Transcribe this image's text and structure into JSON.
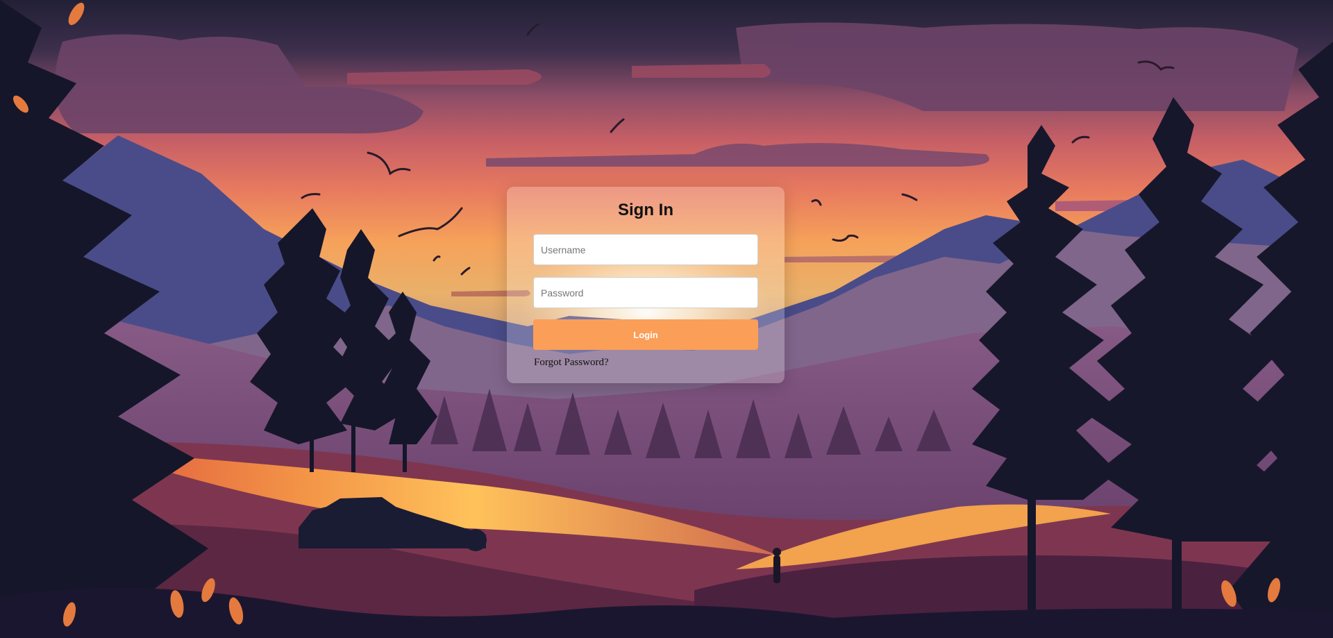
{
  "login": {
    "title": "Sign In",
    "username_placeholder": "Username",
    "password_placeholder": "Password",
    "username_value": "",
    "password_value": "",
    "login_label": "Login",
    "forgot_label": "Forgot Password?"
  },
  "theme": {
    "accent": "#fb9e58",
    "sky_top": "#252238",
    "sky_glow": "#f6a25a",
    "mountain": "#3a3f77",
    "forest": "#141428"
  }
}
